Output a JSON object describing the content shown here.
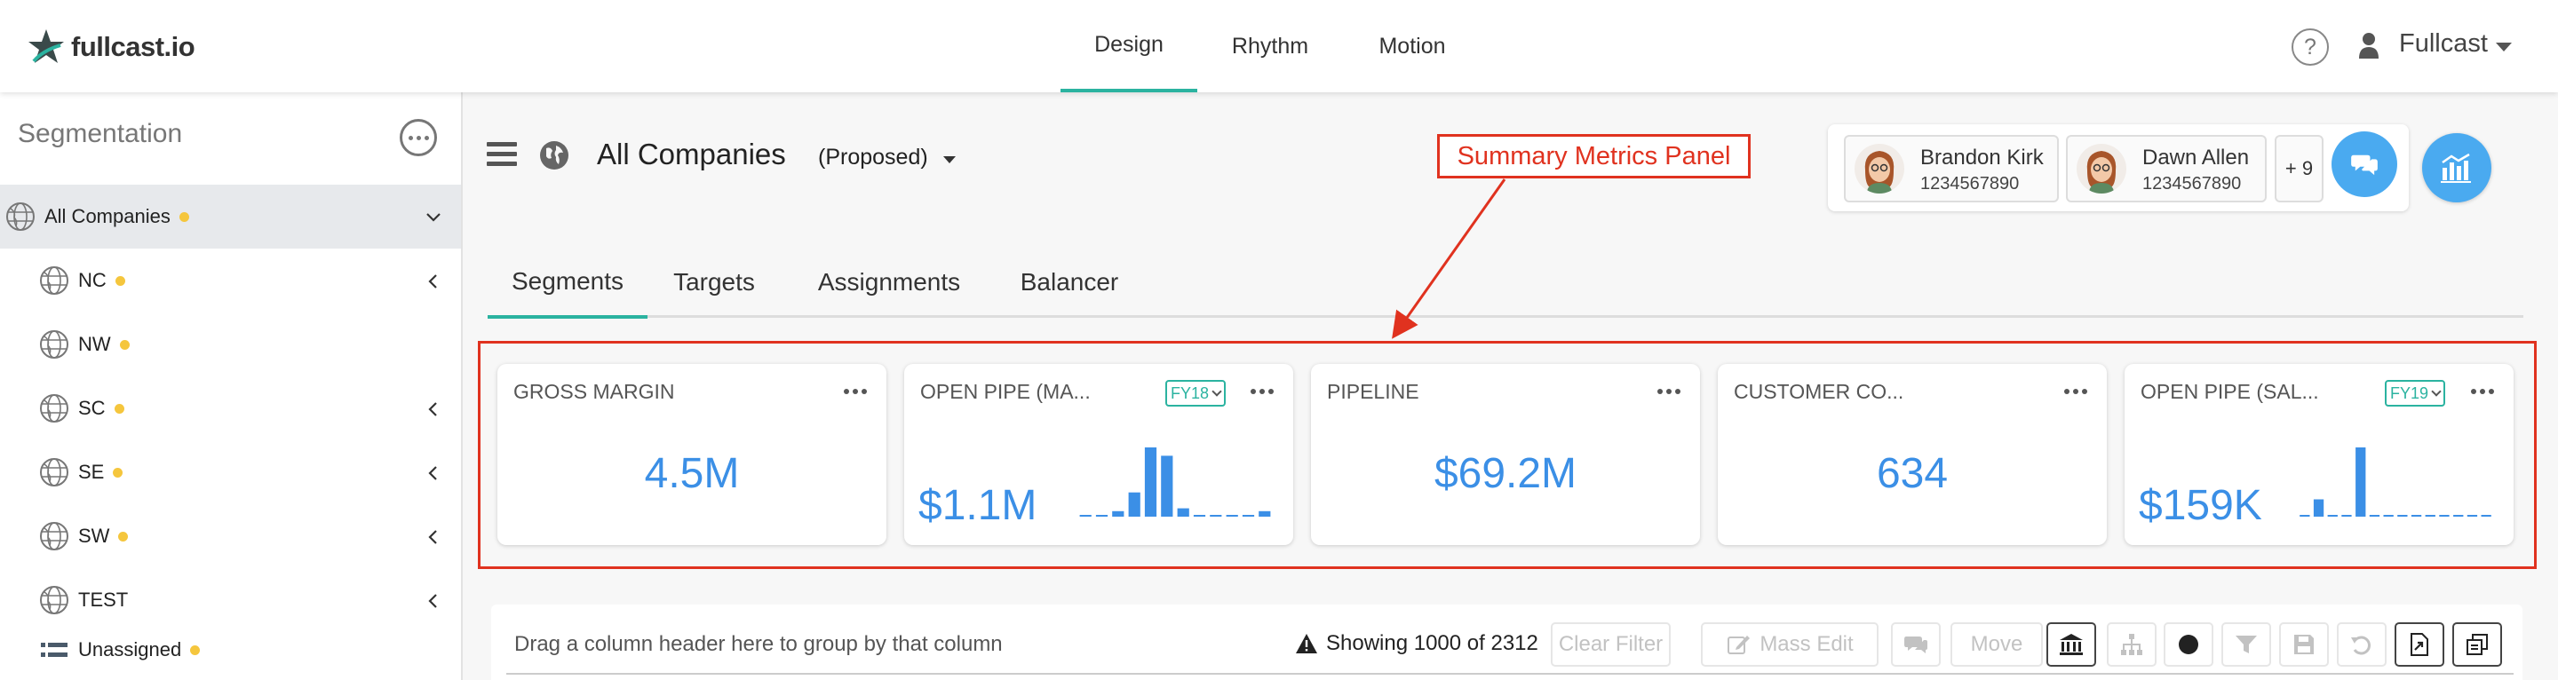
{
  "app": {
    "logo_text": "fullcast.io",
    "nav": [
      {
        "label": "Design",
        "active": true
      },
      {
        "label": "Rhythm",
        "active": false
      },
      {
        "label": "Motion",
        "active": false
      }
    ],
    "help_label": "?",
    "user_label": "Fullcast"
  },
  "sidebar": {
    "title": "Segmentation",
    "items": [
      {
        "label": "All Companies",
        "icon": "globe-icon",
        "dot": true,
        "chevron": "down",
        "selected": true
      },
      {
        "label": "NC",
        "icon": "globe-icon",
        "dot": true,
        "chevron": "left"
      },
      {
        "label": "NW",
        "icon": "globe-icon",
        "dot": true,
        "chevron": null
      },
      {
        "label": "SC",
        "icon": "globe-icon",
        "dot": true,
        "chevron": "left"
      },
      {
        "label": "SE",
        "icon": "globe-icon",
        "dot": true,
        "chevron": "left"
      },
      {
        "label": "SW",
        "icon": "globe-icon",
        "dot": true,
        "chevron": "left"
      },
      {
        "label": "TEST",
        "icon": "globe-icon",
        "dot": false,
        "chevron": "left"
      },
      {
        "label": "Unassigned",
        "icon": "list-icon",
        "dot": true,
        "chevron": null
      }
    ]
  },
  "header": {
    "title": "All Companies",
    "subtitle": "(Proposed)"
  },
  "collaborators": {
    "people": [
      {
        "name": "Brandon Kirk",
        "phone": "1234567890"
      },
      {
        "name": "Dawn Allen",
        "phone": "1234567890"
      }
    ],
    "more": "+ 9"
  },
  "tabs": [
    {
      "label": "Segments",
      "active": true
    },
    {
      "label": "Targets",
      "active": false
    },
    {
      "label": "Assignments",
      "active": false
    },
    {
      "label": "Balancer",
      "active": false
    }
  ],
  "annotation": {
    "label": "Summary Metrics Panel",
    "color": "#e0321f"
  },
  "metrics": [
    {
      "title": "GROSS MARGIN",
      "value": "4.5M",
      "badge": null,
      "bars": null
    },
    {
      "title": "OPEN PIPE (MA...",
      "value": "$1.1M",
      "badge": "FY18",
      "bars": [
        0.02,
        0.02,
        0.08,
        0.35,
        1.0,
        0.88,
        0.12,
        0.02,
        0.02,
        0.02,
        0.02,
        0.08
      ]
    },
    {
      "title": "PIPELINE",
      "value": "$69.2M",
      "badge": null,
      "bars": null
    },
    {
      "title": "CUSTOMER CO...",
      "value": "634",
      "badge": null,
      "bars": null
    },
    {
      "title": "OPEN PIPE (SAL...",
      "value": "$159K",
      "badge": "FY19",
      "bars": [
        0.0,
        0.25,
        0.02,
        0.02,
        1.0,
        0.02,
        0.02,
        0.02,
        0.02,
        0.02,
        0.02,
        0.02,
        0.02,
        0.02
      ]
    }
  ],
  "grid_toolbar": {
    "group_hint": "Drag a column header here to group by that column",
    "showing": "Showing 1000 of 2312",
    "clear_filter": "Clear Filter",
    "mass_edit": "Mass Edit",
    "move": "Move"
  },
  "colors": {
    "accent_teal": "#2bb3a0",
    "metric_blue": "#3b8fe6",
    "button_blue": "#4aaaf0",
    "status_dot": "#f5c63d"
  }
}
